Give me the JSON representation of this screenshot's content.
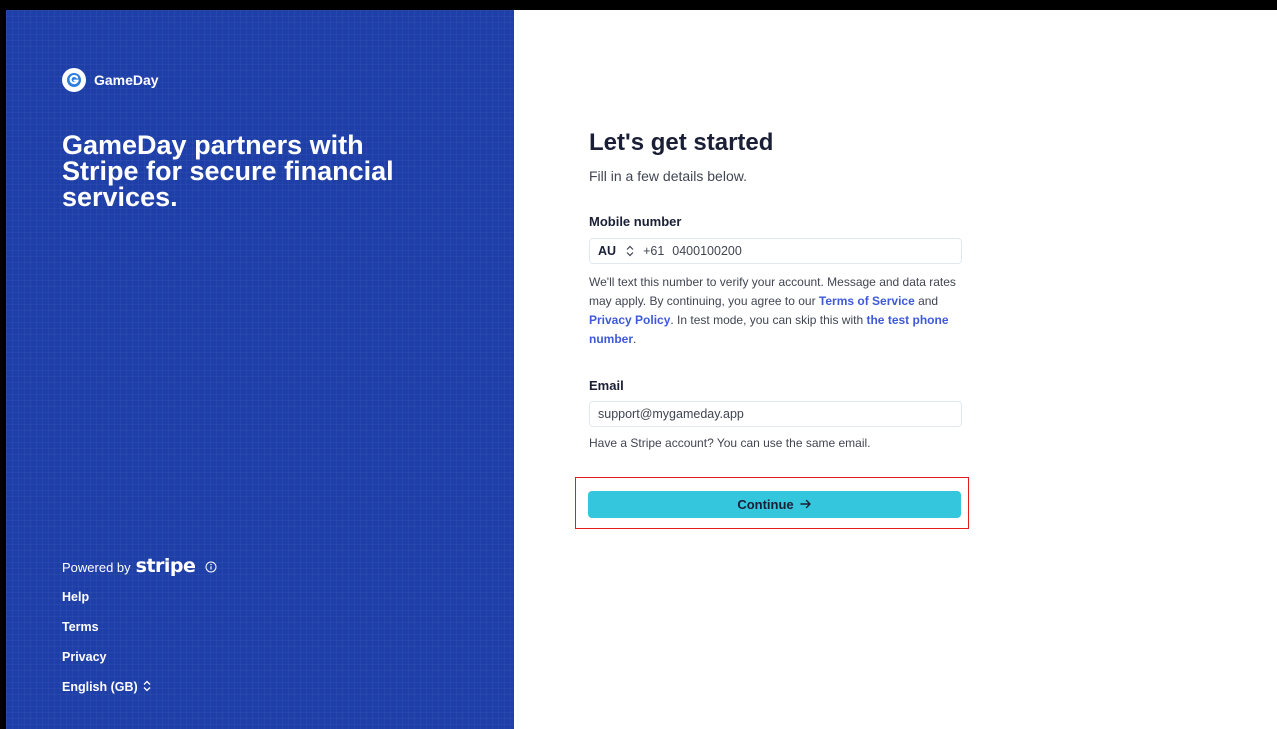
{
  "brand": {
    "name": "GameDay",
    "panel_color": "#1f3fa8"
  },
  "left_panel": {
    "headline": "GameDay partners with Stripe for secure financial services.",
    "powered_by": "Powered by",
    "stripe_wordmark": "stripe",
    "links": {
      "help": "Help",
      "terms": "Terms",
      "privacy": "Privacy",
      "language": "English (GB)"
    }
  },
  "form": {
    "title": "Let's get started",
    "subtitle": "Fill in a few details below.",
    "mobile": {
      "label": "Mobile number",
      "country": "AU",
      "dial_code": "+61",
      "value": "0400100200",
      "help_prefix": "We'll text this number to verify your account. Message and data rates may apply. By continuing, you agree to our ",
      "terms_link": "Terms of Service",
      "help_and": " and ",
      "privacy_link": "Privacy Policy",
      "help_middle": ". In test mode, you can skip this with ",
      "test_phone_link": "the test phone number",
      "help_suffix": "."
    },
    "email": {
      "label": "Email",
      "value": "support@mygameday.app",
      "help": "Have a Stripe account? You can use the same email."
    },
    "continue_label": "Continue",
    "continue_color": "#33c6dc",
    "highlight_color": "#e11d1d"
  }
}
